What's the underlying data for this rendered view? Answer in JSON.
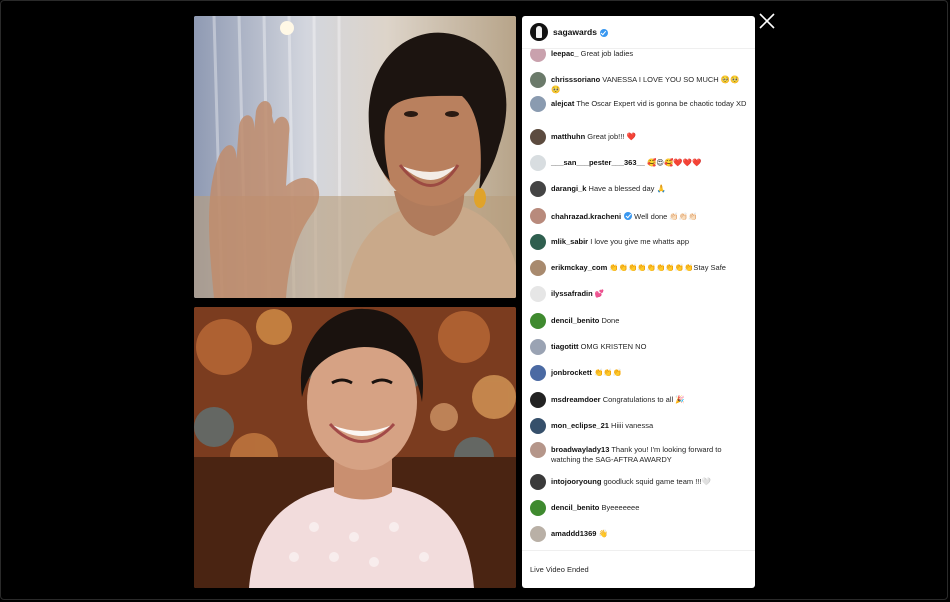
{
  "host": {
    "username": "sagawards",
    "verified": true
  },
  "comments": [
    {
      "user": "leepac_",
      "text": "Great job ladies",
      "avatar_color": "#c9a1ad"
    },
    {
      "user": "chrisssoriano",
      "text": "VANESSA I LOVE YOU SO MUCH 🥺🥺🥺",
      "avatar_color": "#6b7a6a"
    },
    {
      "user": "alejcat",
      "text": "The Oscar Expert vid is gonna be chaotic today XD",
      "avatar_color": "#8a9bb0"
    },
    {
      "user": "matthuhn",
      "text": "Great job!!! ❤️",
      "avatar_color": "#5c4b3f"
    },
    {
      "user": "___san___pester___363__",
      "text": "🥰😍🥰❤️❤️❤️",
      "avatar_color": "#d8dde0"
    },
    {
      "user": "darangi_k",
      "text": "Have a blessed day 🙏",
      "avatar_color": "#444444"
    },
    {
      "user": "chahrazad.kracheni",
      "text": "Well done 👏🏻👏🏻👏🏻",
      "avatar_color": "#b88a7c",
      "verified": true
    },
    {
      "user": "mlik_sabir",
      "text": "I love you give me whatts app",
      "avatar_color": "#2f5f4f"
    },
    {
      "user": "erikmckay_com",
      "text": "👏👏👏👏👏👏👏👏👏Stay Safe",
      "avatar_color": "#a88a6e"
    },
    {
      "user": "ilyssafradin",
      "text": "💕",
      "avatar_color": "#e6e6e6"
    },
    {
      "user": "dencil_benito",
      "text": "Done",
      "avatar_color": "#3f8a2f"
    },
    {
      "user": "tiagotitt",
      "text": "OMG KRISTEN NO",
      "avatar_color": "#9aa3b3"
    },
    {
      "user": "jonbrockett",
      "text": "👏👏👏",
      "avatar_color": "#4b6aa3"
    },
    {
      "user": "msdreamdoer",
      "text": "Congratulations to all 🎉",
      "avatar_color": "#222222"
    },
    {
      "user": "mon_eclipse_21",
      "text": "Hiiii vanessa",
      "avatar_color": "#36506b"
    },
    {
      "user": "broadwaylady13",
      "text": "Thank you! I'm looking forward to watching the SAG-AFTRA AWARDY",
      "avatar_color": "#b5968a"
    },
    {
      "user": "intojooryoung",
      "text": "goodluck squid game team !!!🤍",
      "avatar_color": "#3a3a3a"
    },
    {
      "user": "dencil_benito",
      "text": "Byeeeeeee",
      "avatar_color": "#3f8a2f"
    },
    {
      "user": "amaddd1369",
      "text": "👋",
      "avatar_color": "#b9b0a6"
    }
  ],
  "footer": {
    "status": "Live Video Ended"
  },
  "videos": [
    {
      "participant": "top-guest"
    },
    {
      "participant": "bottom-guest"
    }
  ]
}
